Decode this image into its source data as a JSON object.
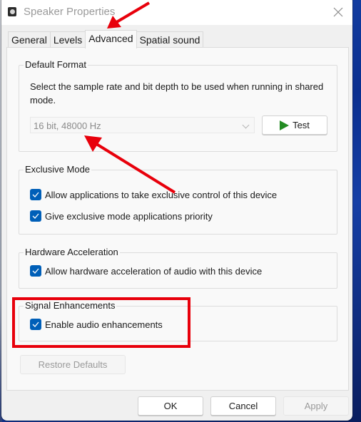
{
  "window": {
    "title": "Speaker Properties",
    "icon": "speaker-icon",
    "close_icon": "close-icon"
  },
  "tabs": [
    {
      "label": "General",
      "active": false
    },
    {
      "label": "Levels",
      "active": false
    },
    {
      "label": "Advanced",
      "active": true
    },
    {
      "label": "Spatial sound",
      "active": false
    }
  ],
  "default_format": {
    "label": "Default Format",
    "description": "Select the sample rate and bit depth to be used when running in shared mode.",
    "selected_format": "16 bit, 48000 Hz",
    "test_button": "Test",
    "test_icon": "play-icon"
  },
  "exclusive_mode": {
    "label": "Exclusive Mode",
    "options": [
      {
        "label": "Allow applications to take exclusive control of this device",
        "checked": true
      },
      {
        "label": "Give exclusive mode applications priority",
        "checked": true
      }
    ]
  },
  "hardware_acceleration": {
    "label": "Hardware Acceleration",
    "options": [
      {
        "label": "Allow hardware acceleration of audio with this device",
        "checked": true
      }
    ]
  },
  "signal_enhancements": {
    "label": "Signal Enhancements",
    "options": [
      {
        "label": "Enable audio enhancements",
        "checked": true
      }
    ]
  },
  "buttons": {
    "restore_defaults": "Restore Defaults",
    "ok": "OK",
    "cancel": "Cancel",
    "apply": "Apply"
  },
  "colors": {
    "accent": "#005fb8",
    "annotation": "#e8000b",
    "play_green": "#228b22"
  },
  "annotations": {
    "arrows": [
      "arrow-to-advanced-tab",
      "arrow-to-format-dropdown"
    ],
    "highlight": "signal-enhancements-highlight"
  }
}
